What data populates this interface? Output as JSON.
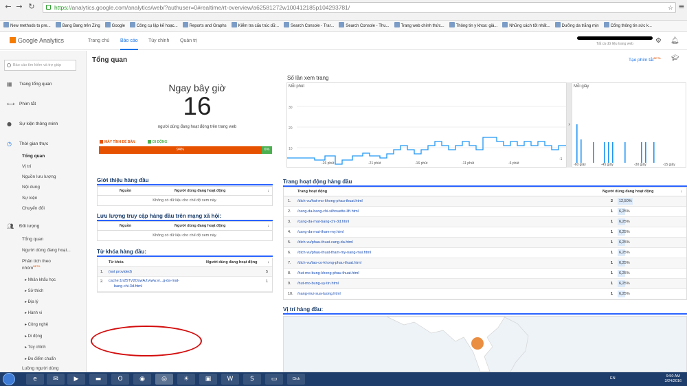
{
  "browser": {
    "url_scheme": "https://",
    "url_rest": "analytics.google.com/analytics/web/?authuser=0#realtime/rt-overview/a62581272w100412185p104293781/",
    "bookmarks": [
      "New methods to pre...",
      "Bang Bang trên Zing",
      "Google",
      "Công cụ lập kế hoạc...",
      "Reports and Graphs",
      "Kiểm tra cấu trúc dữ...",
      "Search Console - Trar...",
      "Search Console - Thu...",
      "Trang web chính thức...",
      "Thông tin y khoa: giả...",
      "Những cách tốt nhất...",
      "Dưỡng da trắng mịn",
      "Cổng thông tin sức k..."
    ]
  },
  "header": {
    "logo": "Google Analytics",
    "tabs": [
      "Trang chủ",
      "Báo cáo",
      "Tùy chỉnh",
      "Quản trị"
    ],
    "account_sub": "Tất cả dữ liệu trang web"
  },
  "sidebar": {
    "search_placeholder": "Báo cáo tìm kiếm và trợ giúp",
    "items": [
      "Trang tổng quan",
      "Phím tắt",
      "Sự kiện thông minh",
      "Thời gian thực"
    ],
    "realtime_sub": [
      "Tổng quan",
      "Vị trí",
      "Nguồn lưu lượng",
      "Nội dung",
      "Sự kiện",
      "Chuyển đổi"
    ],
    "audience": "Đối tượng",
    "audience_sub": [
      "Tổng quan",
      "Người dùng đang hoạt...",
      "Phân tích theo",
      "nhóm"
    ],
    "beta": "BETA",
    "audience_sub2": [
      "▸ Nhân khẩu học",
      "▸ Sở thích",
      "▸ Địa lý",
      "▸ Hành vi",
      "▸ Công nghệ",
      "▸ Di động",
      "▸ Tùy chỉnh",
      "▸ Đo điểm chuẩn",
      "Luồng người dùng"
    ]
  },
  "main": {
    "title": "Tổng quan",
    "shortcut": "Tạo phím tắt",
    "shortcut_beta": "BETA",
    "now_label": "Ngay bây giờ",
    "now_count": "16",
    "now_sub": "người dùng đang hoạt động trên trang web",
    "legend_desktop": "MÁY TÍNH ĐỂ BÀN",
    "legend_mobile": "DI ĐỘNG",
    "desktop_pct": "94%",
    "mobile_pct": "6%",
    "desktop_fraction": 0.94,
    "referrals_title": "Giới thiệu hàng đầu",
    "social_title": "Lưu lượng truy cập hàng đầu trên mạng xã hội:",
    "col_source": "Nguồn",
    "col_active": "Người dùng đang hoạt động",
    "sort_arrow": "↓",
    "no_data": "Không có dữ liệu cho chế độ xem này.",
    "keywords_title": "Từ khóa hàng đầu:",
    "col_keyword": "Từ khóa",
    "keywords": [
      {
        "n": "1.",
        "k": "(not provided)",
        "v": "5"
      },
      {
        "n": "2.",
        "k": "cache:1n25TV2OswAJ:www.vi...g-da-mat-",
        "k2": "bang-chi-3d.html",
        "v": "1"
      }
    ],
    "pageviews_title": "Số lần xem trang",
    "per_minute": "Mỗi phút",
    "per_second": "Mỗi giây",
    "ylabels": [
      "30",
      "20",
      "10"
    ],
    "xlabels_min": [
      "-26 phút",
      "-21 phút",
      "-16 phút",
      "-11 phút",
      "-6 phút",
      "-1"
    ],
    "xlabels_sec": [
      "-60 giây",
      "-45 giây",
      "-30 giây",
      "-15 giây"
    ],
    "pages_title": "Trang hoạt động hàng đầu",
    "col_page": "Trang hoạt động",
    "pages": [
      {
        "n": "1.",
        "p": "/dich-vu/hut-mo-khong-phau-thuat.html",
        "v": "2",
        "pct": "12,50%"
      },
      {
        "n": "2.",
        "p": "/cang-da-bang-chi-silhouette-lift.html",
        "v": "1",
        "pct": "6,25%"
      },
      {
        "n": "3.",
        "p": "/cang-da-mat-bang-chi-3d.html",
        "v": "1",
        "pct": "6,25%"
      },
      {
        "n": "4.",
        "p": "/cang-da-mat-tham-my.html",
        "v": "1",
        "pct": "6,25%"
      },
      {
        "n": "5.",
        "p": "/dich-vu/phau-thuat-cang-da.html",
        "v": "1",
        "pct": "6,25%"
      },
      {
        "n": "6.",
        "p": "/dich-vu/phau-thuat-tham-my-nang-mui.html",
        "v": "1",
        "pct": "6,25%"
      },
      {
        "n": "7.",
        "p": "/dich-vu/tao-co-khong-phau-thuat.html",
        "v": "1",
        "pct": "6,25%"
      },
      {
        "n": "8.",
        "p": "/hut-mo-bung-khong-phau-thuat.html",
        "v": "1",
        "pct": "6,25%"
      },
      {
        "n": "9.",
        "p": "/hut-mo-bung-uy-tin.html",
        "v": "1",
        "pct": "6,25%"
      },
      {
        "n": "10.",
        "p": "/nang-mui-sua-tuong.html",
        "v": "1",
        "pct": "6,25%"
      }
    ],
    "locations_title": "Vị trí hàng đầu:"
  },
  "taskbar": {
    "lang": "EN",
    "time": "9:50 AM",
    "date": "3/24/2016",
    "click_label": "Click"
  },
  "colors": {
    "desktop": "#e65100",
    "mobile": "#4caf50",
    "accent": "#1a73e8",
    "annotation": "#d30d0d",
    "chart_line": "#2196f3"
  }
}
